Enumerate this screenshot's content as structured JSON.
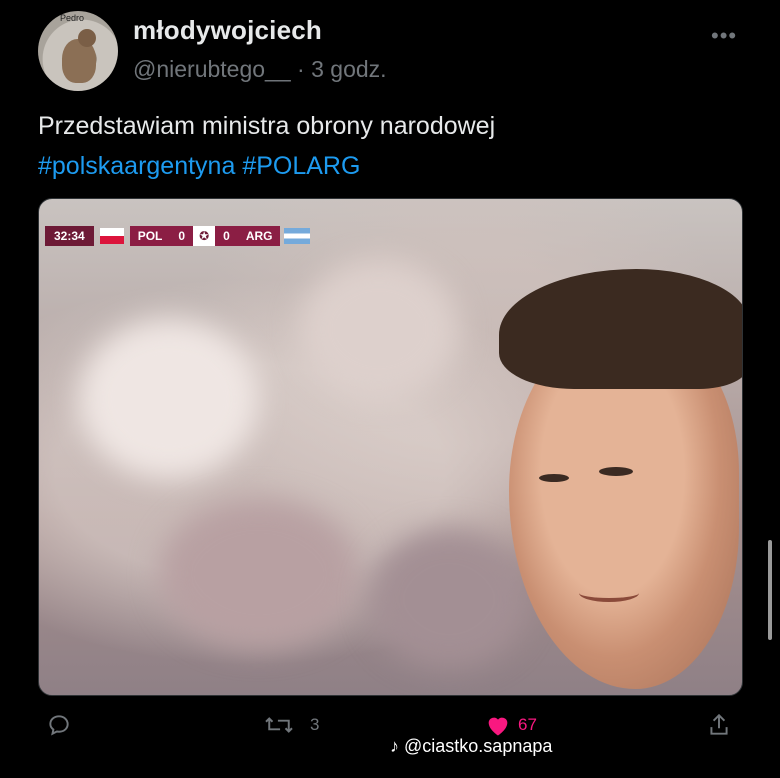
{
  "tweet": {
    "display_name": "młodywojciech",
    "handle": "@nierubtego__",
    "separator": "·",
    "time": "3 godz.",
    "avatar_tag": "Pedro",
    "text": "Przedstawiam ministra obrony narodowej",
    "hashtags": [
      "#polskaargentyna",
      "#POLARG"
    ]
  },
  "media": {
    "scoreboard": {
      "clock": "32:34",
      "home": "POL",
      "home_score": "0",
      "away_score": "0",
      "away": "ARG"
    }
  },
  "actions": {
    "retweets": "3",
    "likes": "67"
  },
  "watermark": "@ciastko.sapnapa",
  "colors": {
    "background": "#000000",
    "hashtag": "#1d9bf0",
    "muted": "#71767b",
    "like": "#f91880"
  }
}
